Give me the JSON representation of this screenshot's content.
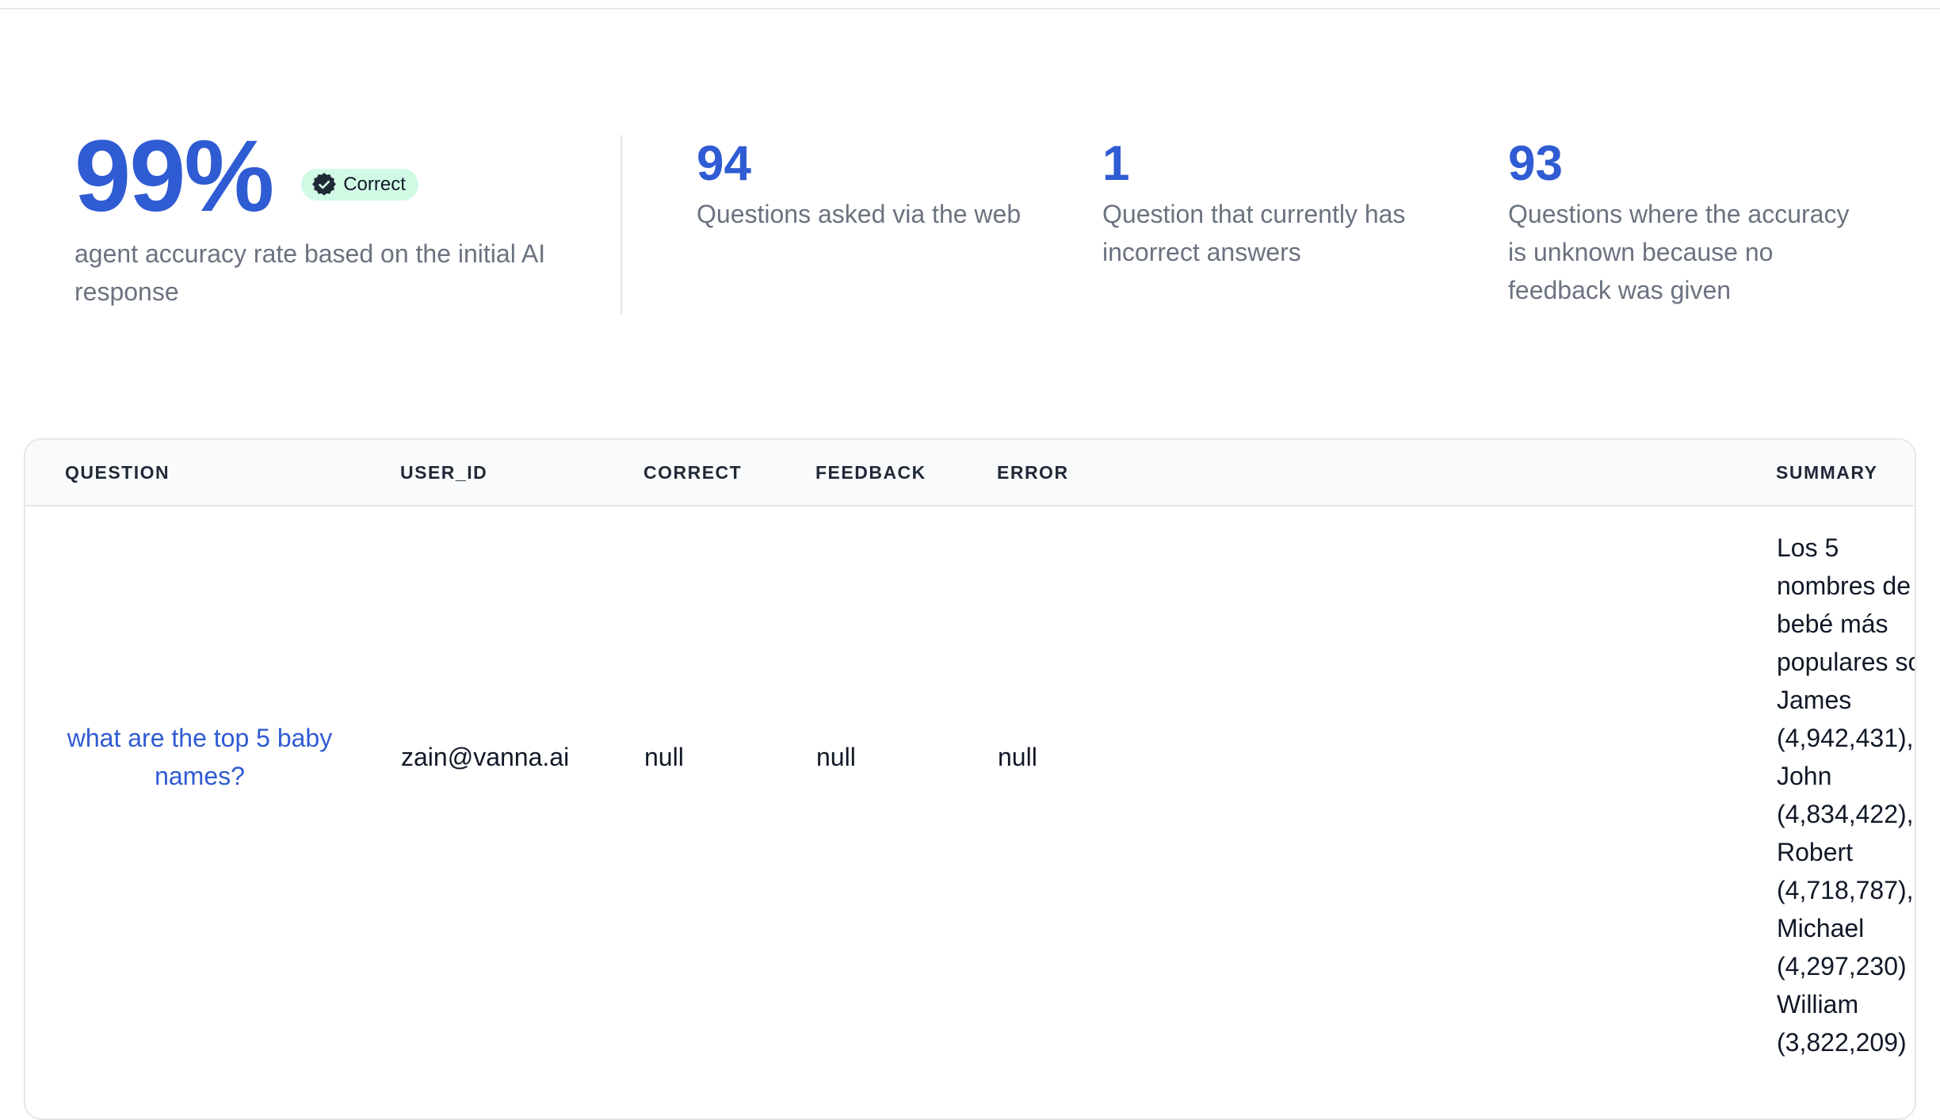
{
  "hero": {
    "value": "99%",
    "badge": "Correct",
    "description": "agent accuracy rate based on the initial AI response"
  },
  "stats": [
    {
      "value": "94",
      "label": "Questions asked via the web"
    },
    {
      "value": "1",
      "label": "Question that currently has incorrect answers"
    },
    {
      "value": "93",
      "label": "Questions where the accuracy is unknown because no feedback was given"
    }
  ],
  "table": {
    "columns": [
      "QUESTION",
      "USER_ID",
      "CORRECT",
      "FEEDBACK",
      "ERROR",
      "SUMMARY"
    ],
    "rows": [
      {
        "question": "what are the top 5 baby names?",
        "user_id": "zain@vanna.ai",
        "correct": "null",
        "feedback": "null",
        "error": "null",
        "summary_lines": [
          "Los 5",
          "nombres de",
          "bebé más",
          "populares so",
          "James",
          "(4,942,431),",
          "John",
          "(4,834,422),",
          "Robert",
          "(4,718,787),",
          "Michael",
          "(4,297,230)",
          "William",
          "(3,822,209)"
        ]
      }
    ]
  },
  "colors": {
    "accent": "#2f5bd3",
    "badge_bg": "#d1fae5",
    "muted_text": "#6b7280",
    "border": "#e5e7eb",
    "header_bg": "#f9fafb"
  }
}
